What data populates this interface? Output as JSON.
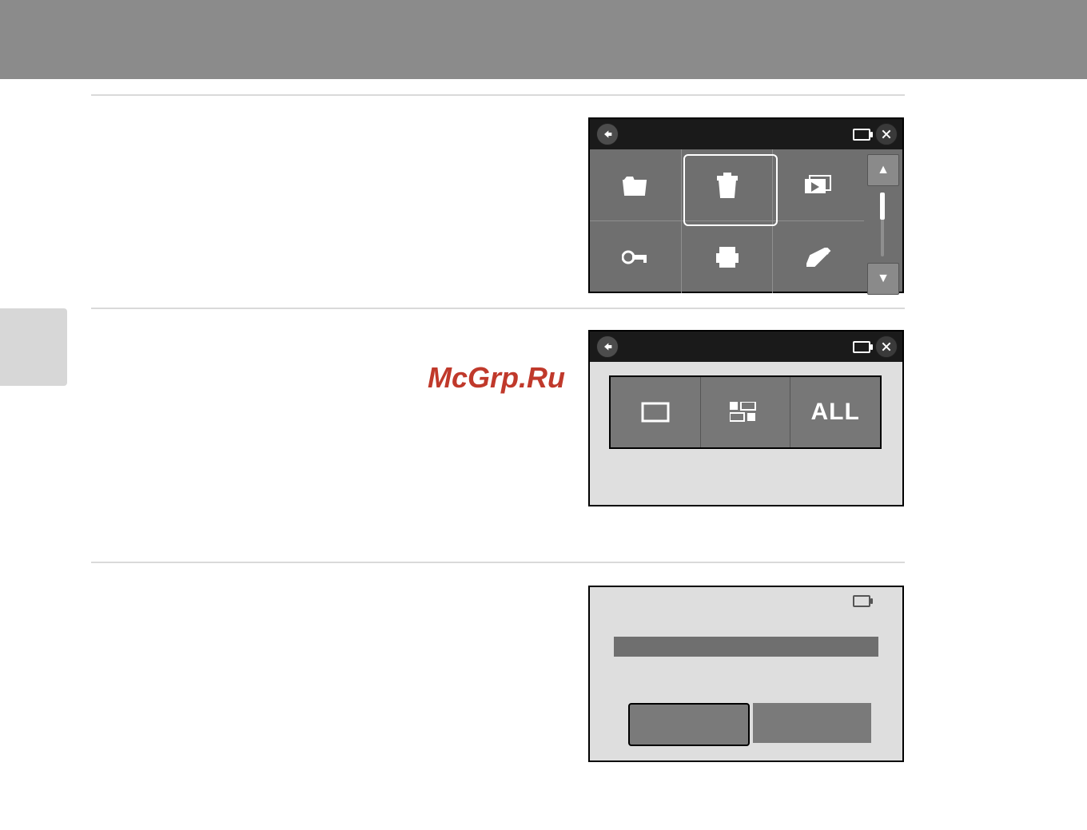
{
  "watermark": "McGrp.Ru",
  "panel1": {
    "icons": [
      "favorites",
      "trash",
      "slideshow",
      "protect",
      "print",
      "edit"
    ],
    "selected_index": 1
  },
  "panel2": {
    "options": [
      "single",
      "multi",
      "all"
    ],
    "all_label": "ALL"
  },
  "panel3": {}
}
